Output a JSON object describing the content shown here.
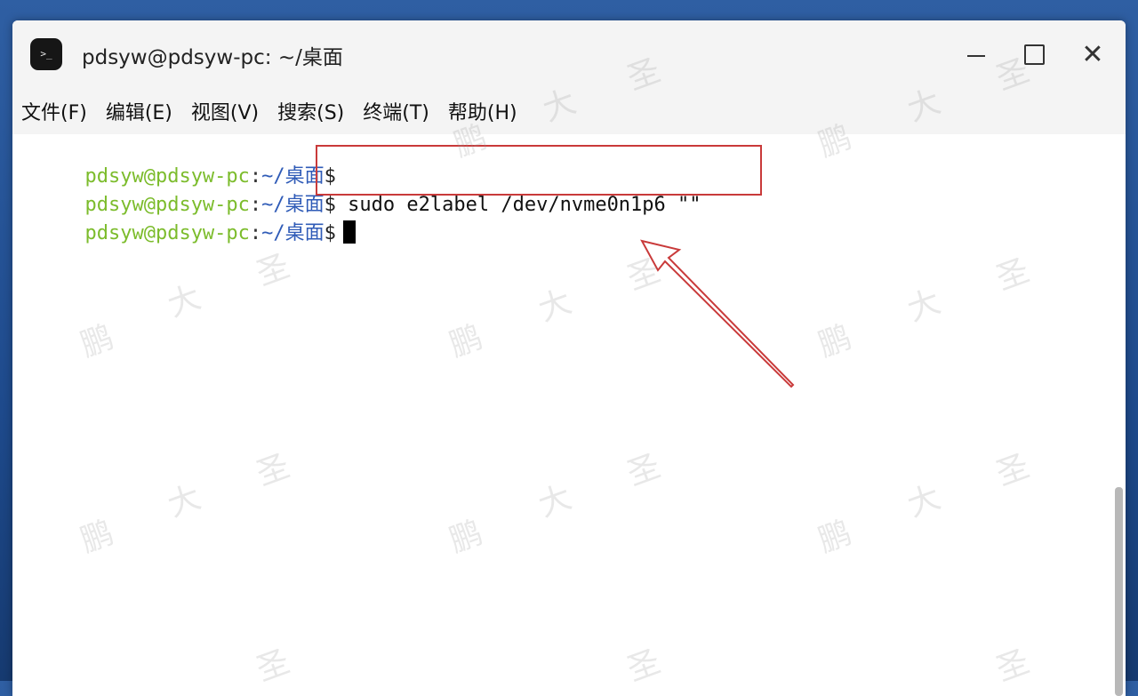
{
  "window": {
    "title": "pdsyw@pdsyw-pc: ~/桌面",
    "app_icon_glyph": ">_",
    "close_glyph": "✕"
  },
  "menu": {
    "items": [
      {
        "label": "文件(F)"
      },
      {
        "label": "编辑(E)"
      },
      {
        "label": "视图(V)"
      },
      {
        "label": "搜索(S)"
      },
      {
        "label": "终端(T)"
      },
      {
        "label": "帮助(H)"
      }
    ]
  },
  "terminal": {
    "prompt_user": "pdsyw@pdsyw-pc",
    "prompt_colon": ":",
    "prompt_path": "~/桌面",
    "prompt_dollar": "$",
    "lines": [
      {
        "command": ""
      },
      {
        "command": "sudo e2label /dev/nvme0n1p6 \"\""
      },
      {
        "command": ""
      }
    ]
  },
  "colors": {
    "prompt_user": "#7cbc2c",
    "prompt_path": "#2f5bb7",
    "annotation": "#c93a3a"
  },
  "watermark": {
    "chars": [
      "鹏",
      "大",
      "圣"
    ]
  }
}
